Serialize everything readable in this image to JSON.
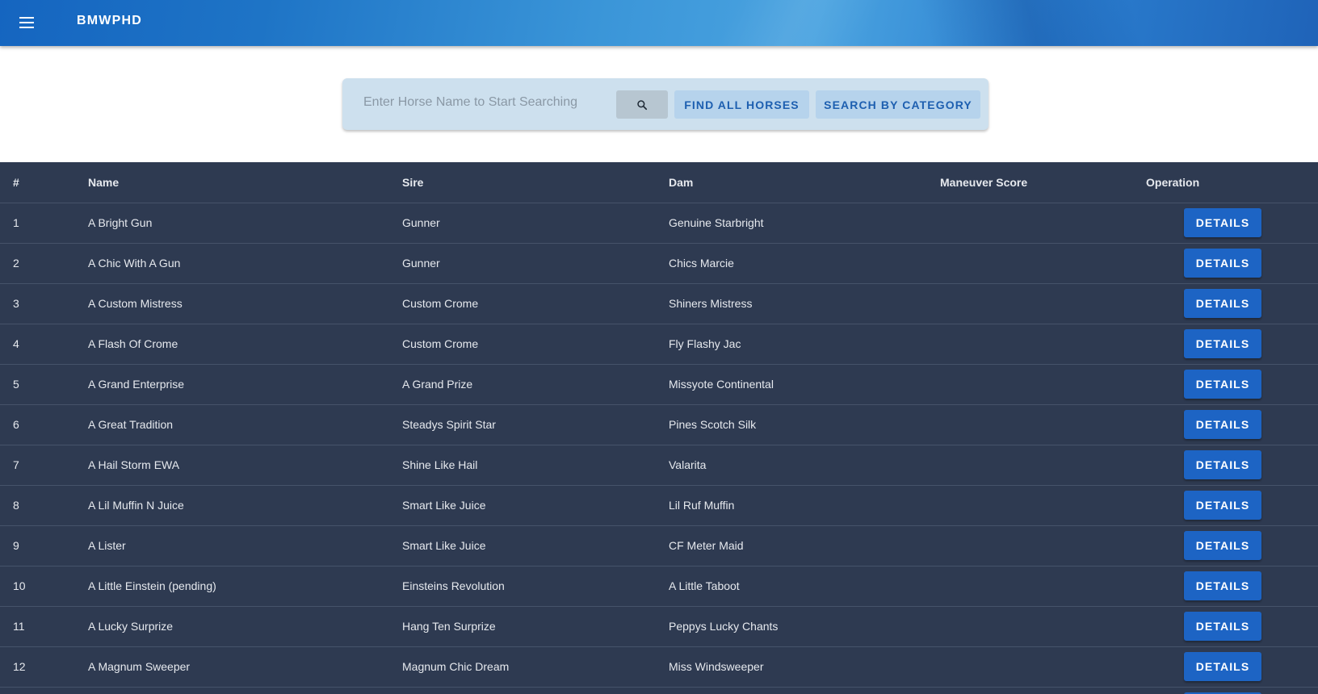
{
  "app": {
    "title": "BMWPHD"
  },
  "search": {
    "placeholder": "Enter Horse Name to Start Searching",
    "find_all_label": "FIND ALL HORSES",
    "by_category_label": "SEARCH BY CATEGORY"
  },
  "table": {
    "headers": [
      "#",
      "Name",
      "Sire",
      "Dam",
      "Maneuver Score",
      "Operation"
    ],
    "action_label": "DETAILS",
    "rows": [
      {
        "num": "1",
        "name": "A Bright Gun",
        "sire": "Gunner",
        "dam": "Genuine Starbright",
        "score": ""
      },
      {
        "num": "2",
        "name": "A Chic With A Gun",
        "sire": "Gunner",
        "dam": "Chics Marcie",
        "score": ""
      },
      {
        "num": "3",
        "name": "A Custom Mistress",
        "sire": "Custom Crome",
        "dam": "Shiners Mistress",
        "score": ""
      },
      {
        "num": "4",
        "name": "A Flash Of Crome",
        "sire": "Custom Crome",
        "dam": "Fly Flashy Jac",
        "score": ""
      },
      {
        "num": "5",
        "name": "A Grand Enterprise",
        "sire": "A Grand Prize",
        "dam": "Missyote Continental",
        "score": ""
      },
      {
        "num": "6",
        "name": "A Great Tradition",
        "sire": "Steadys Spirit Star",
        "dam": "Pines Scotch Silk",
        "score": ""
      },
      {
        "num": "7",
        "name": "A Hail Storm EWA",
        "sire": "Shine Like Hail",
        "dam": "Valarita",
        "score": ""
      },
      {
        "num": "8",
        "name": "A Lil Muffin N Juice",
        "sire": "Smart Like Juice",
        "dam": "Lil Ruf Muffin",
        "score": ""
      },
      {
        "num": "9",
        "name": "A Lister",
        "sire": "Smart Like Juice",
        "dam": "CF Meter Maid",
        "score": ""
      },
      {
        "num": "10",
        "name": "A Little Einstein (pending)",
        "sire": "Einsteins Revolution",
        "dam": "A Little Taboot",
        "score": ""
      },
      {
        "num": "11",
        "name": "A Lucky Surprize",
        "sire": "Hang Ten Surprize",
        "dam": "Peppys Lucky Chants",
        "score": ""
      },
      {
        "num": "12",
        "name": "A Magnum Sweeper",
        "sire": "Magnum Chic Dream",
        "dam": "Miss Windsweeper",
        "score": ""
      },
      {
        "num": "",
        "name": "",
        "sire": "",
        "dam": "",
        "score": ""
      }
    ]
  },
  "icons": {
    "menu": "menu-icon",
    "search": "search-icon"
  },
  "colors": {
    "appbar": "#1e74c6",
    "table_bg": "#2e3a51",
    "details_button": "#1d64c4"
  }
}
